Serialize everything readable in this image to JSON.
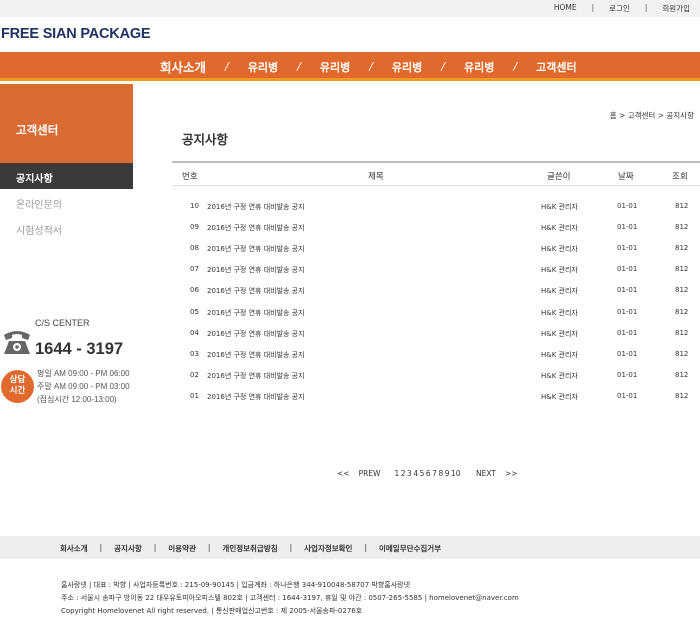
{
  "topbar": {
    "links": [
      "HOME",
      "로그인",
      "회원가입"
    ],
    "separator": "|"
  },
  "logo": {
    "text": "FREE SIAN PACKAGE"
  },
  "mainnav": {
    "items": [
      "회사소개",
      "유리병",
      "유리병",
      "유리병",
      "유리병",
      "고객센터"
    ],
    "separator": "/"
  },
  "sidebar": {
    "title": "고객센터",
    "menu": [
      "공지사항",
      "온라인문의",
      "시험성적서"
    ],
    "active_index": 0
  },
  "cs_center": {
    "label": "C/S CENTER",
    "number": "1644 - 3197",
    "badge": [
      "상담",
      "시간"
    ],
    "hours": [
      "평일 AM 09:00 - PM 06:00",
      "주말 AM 09:00 - PM 03:00",
      "(점심시간 12:00-13:00)"
    ]
  },
  "breadcrumb": {
    "text": "홈 > 고객센터 > 공지사항"
  },
  "page": {
    "title": "공지사항"
  },
  "table": {
    "headers": [
      "번호",
      "제목",
      "글쓴이",
      "날짜",
      "조회"
    ],
    "rows": [
      {
        "num": "10",
        "title": "2016년 구정 연휴 대비발송 공지",
        "author": "H&K 관리자",
        "date": "01-01",
        "views": "812"
      },
      {
        "num": "09",
        "title": "2016년 구정 연휴 대비발송 공지",
        "author": "H&K 관리자",
        "date": "01-01",
        "views": "812"
      },
      {
        "num": "08",
        "title": "2016년 구정 연휴 대비발송 공지",
        "author": "H&K 관리자",
        "date": "01-01",
        "views": "812"
      },
      {
        "num": "07",
        "title": "2016년 구정 연휴 대비발송 공지",
        "author": "H&K 관리자",
        "date": "01-01",
        "views": "812"
      },
      {
        "num": "06",
        "title": "2016년 구정 연휴 대비발송 공지",
        "author": "H&K 관리자",
        "date": "01-01",
        "views": "812"
      },
      {
        "num": "05",
        "title": "2016년 구정 연휴 대비발송 공지",
        "author": "H&K 관리자",
        "date": "01-01",
        "views": "812"
      },
      {
        "num": "04",
        "title": "2016년 구정 연휴 대비발송 공지",
        "author": "H&K 관리자",
        "date": "01-01",
        "views": "812"
      },
      {
        "num": "03",
        "title": "2016년 구정 연휴 대비발송 공지",
        "author": "H&K 관리자",
        "date": "01-01",
        "views": "812"
      },
      {
        "num": "02",
        "title": "2016년 구정 연휴 대비발송 공지",
        "author": "H&K 관리자",
        "date": "01-01",
        "views": "812"
      },
      {
        "num": "01",
        "title": "2016년 구정 연휴 대비발송 공지",
        "author": "H&K 관리자",
        "date": "01-01",
        "views": "812"
      }
    ]
  },
  "pagination": {
    "first": "<<",
    "prev": "PREW",
    "pages": [
      "1",
      "2",
      "3",
      "4",
      "5",
      "6",
      "7",
      "8",
      "9",
      "10"
    ],
    "next": "NEXT",
    "last": ">>"
  },
  "footer": {
    "nav": [
      "회사소개",
      "공지사항",
      "이용약관",
      "개인정보취급방침",
      "사업자정보확인",
      "이메일무단수집거부"
    ],
    "separator": "|",
    "info": [
      "홈사랑넷  |  대표 : 박향  |  사업자등록번호 : 215-09-90145  |  입금계좌 : 하나은행 344-910048-58707 박향홈사랑넷",
      "주소 : 서울시 송파구 방이동 22 대우유토피아오피스텔 802호  |  고객센터 : 1644-3197, 휴일 및 야간 : 0507-265-5585  |  homelovenet@naver.com",
      "Copyright Homelovenet All right reserved.  |  통신판매업신고번호 : 제 2005-서울송파-0276호"
    ]
  },
  "colors": {
    "nav_orange": "#e06a2e",
    "nav_underline": "#f39a1c",
    "logo_navy": "#1f3161",
    "active_menu_bg": "#3a3a3a"
  },
  "icons": [
    "phone-icon"
  ]
}
